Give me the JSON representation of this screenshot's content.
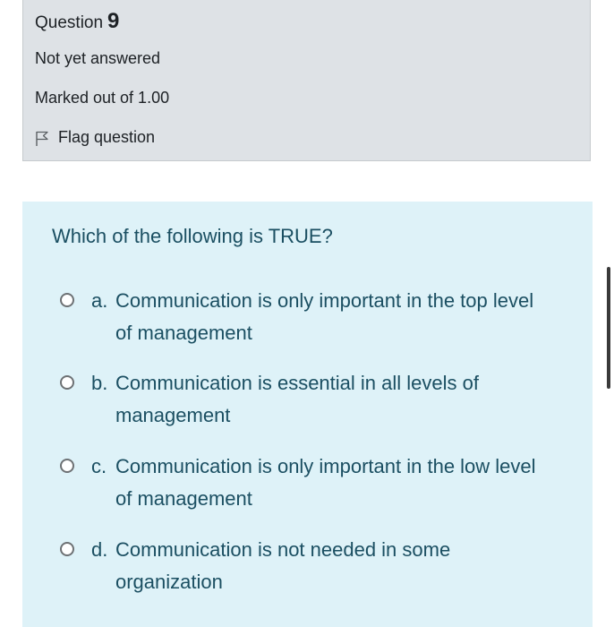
{
  "question": {
    "label": "Question",
    "number": "9",
    "state": "Not yet answered",
    "grade": "Marked out of 1.00",
    "flag_label": "Flag question",
    "text": "Which of the following is TRUE?"
  },
  "answers": [
    {
      "letter": "a.",
      "text": "Communication is only important in the top level of management"
    },
    {
      "letter": "b.",
      "text": "Communication is essential in all levels of management"
    },
    {
      "letter": "c.",
      "text": "Communication is only important in the low level of management"
    },
    {
      "letter": "d.",
      "text": "Communication is not needed in some organization"
    }
  ],
  "icons": {
    "flag": "flag-icon",
    "radio": "radio-unchecked-icon"
  },
  "colors": {
    "info_background": "#dee2e6",
    "content_background": "#def2f8",
    "question_text": "#1b4f62",
    "info_text": "#1d2125"
  }
}
